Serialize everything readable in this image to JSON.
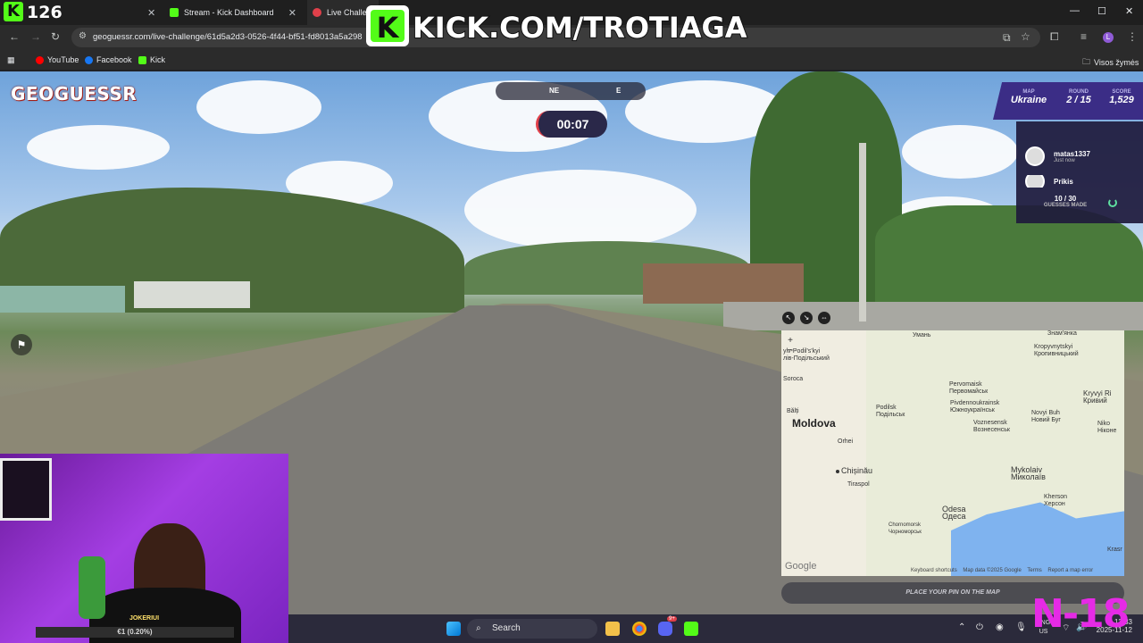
{
  "browser": {
    "tabs": [
      {
        "label": ""
      },
      {
        "label": "Stream - Kick Dashboard"
      },
      {
        "label": "Live Challeng"
      }
    ],
    "url": "geoguessr.com/live-challenge/61d5a2d3-0526-4f44-bf51-fd8013a5a298",
    "bookmarks": [
      "YouTube",
      "Facebook",
      "Kick"
    ],
    "all_bookmarks": "Visos žymės"
  },
  "overlay": {
    "kick_score": "126",
    "banner": "KICK.COM/TROTIAGA",
    "age_badge": "N-18"
  },
  "game": {
    "logo": "GEOGUESSR",
    "compass_left": "NE",
    "compass_right": "E",
    "timer": "00:07",
    "hud": {
      "map_label": "MAP",
      "map_value": "Ukraine",
      "round_label": "ROUND",
      "round_value": "2 / 15",
      "score_label": "SCORE",
      "score_value": "1,529"
    },
    "players": [
      {
        "name": "matas1337",
        "sub": "Just now"
      },
      {
        "name": "Prikis",
        "sub": ""
      }
    ],
    "guesses": "10 / 30",
    "guesses_label": "GUESSES MADE",
    "place_pin": "PLACE YOUR PIN ON THE MAP"
  },
  "map": {
    "labels": {
      "uman": "Умань",
      "kropyvnytskyi": "Kropyvnytskyi\nКропивницький",
      "znamianka": "Знам'янка",
      "khmelnytskyi": "ylv-Podil's'kyi\nлів-Подільський",
      "soroca": "Soroca",
      "pervomaisk": "Pervomaisk\nПервомайськ",
      "kryvyi": "Kryvyi Ri\nКривий",
      "balti": "Bălți",
      "podilsk": "Podilsk\nПодільськ",
      "pivdennoukrainsk": "Pivdennoukrainsk\nЮжноукраїнськ",
      "novyi_buh": "Novyi Buh\nНовий Буг",
      "moldova": "Moldova",
      "voznesensk": "Voznesensk\nВознесенськ",
      "nikopol": "Niko\nНіконе",
      "orhei": "Orhei",
      "chisinau": "Chișinău",
      "mykolaiv": "Mykolaiv\nМиколаїв",
      "tiraspol": "Tiraspol",
      "kherson": "Kherson\nХерсон",
      "odesa": "Odesa\nОдеса",
      "chornomorsk": "Chornomorsk\nЧорноморськ",
      "krasn": "Krasr"
    },
    "footer": [
      "Keyboard shortcuts",
      "Map data ©2025 Google",
      "Terms",
      "Report a map error"
    ],
    "google": "Google"
  },
  "webcam": {
    "name": "JOKERIUI",
    "goal": "€1 (0.20%)"
  },
  "taskbar": {
    "search": "Search",
    "lang": "ENG",
    "region": "US",
    "time": "12:33",
    "date": "2025-11-12",
    "discord_badge": "9+"
  },
  "colors": {
    "hud_bg": "#3b2d86",
    "timer_accent": "#e0404a",
    "kick_green": "#53fc18",
    "badge_magenta": "#e62ae6"
  }
}
